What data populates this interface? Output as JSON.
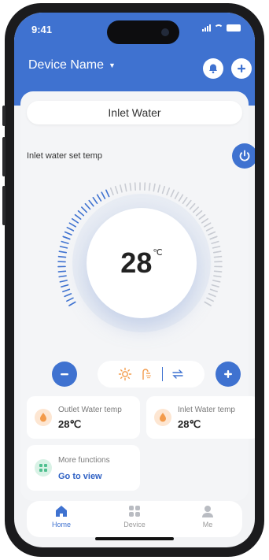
{
  "status_bar": {
    "time": "9:41"
  },
  "header": {
    "device_name": "Device Name",
    "dropdown_arrow": "▼"
  },
  "mode": {
    "label": "Inlet Water"
  },
  "set_temp": {
    "label": "Inlet water set temp",
    "value": "28",
    "unit": "℃"
  },
  "info_cards": [
    {
      "title": "Outlet Water temp",
      "value": "28℃"
    },
    {
      "title": "Inlet Water temp",
      "value": "28℃"
    },
    {
      "title": "More functions",
      "link": "Go to view"
    }
  ],
  "tabs": [
    {
      "label": "Home",
      "icon": "home-icon",
      "active": true
    },
    {
      "label": "Device",
      "icon": "grid-icon",
      "active": false
    },
    {
      "label": "Me",
      "icon": "person-icon",
      "active": false
    }
  ],
  "colors": {
    "accent": "#3f72d0",
    "orange": "#f39b4b",
    "green": "#4fbf8f"
  }
}
